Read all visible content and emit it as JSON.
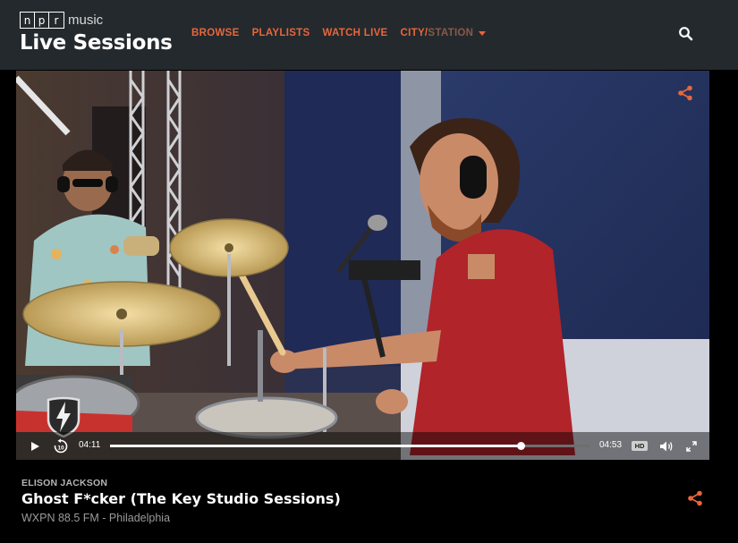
{
  "header": {
    "logo_letters": [
      "n",
      "p",
      "r"
    ],
    "logo_suffix": "music",
    "site_title": "Live Sessions",
    "nav": {
      "browse": "BROWSE",
      "playlists": "PLAYLISTS",
      "watch_live": "WATCH LIVE",
      "city_prefix": "CITY/",
      "city_suffix": "STATION"
    },
    "search_icon": "search-icon"
  },
  "player": {
    "current_time": "04:11",
    "duration": "04:53",
    "progress": 0.857,
    "quality_label": "HD",
    "icons": [
      "play-icon",
      "rewind-10-icon",
      "volume-icon",
      "fullscreen-icon",
      "share-icon"
    ]
  },
  "session": {
    "artist": "ELISON JACKSON",
    "title": "Ghost F*cker (The Key Studio Sessions)",
    "station": "WXPN 88.5 FM - Philadelphia"
  },
  "colors": {
    "accent": "#e8663b",
    "header_bg": "#24292d",
    "page_bg": "#000000"
  }
}
